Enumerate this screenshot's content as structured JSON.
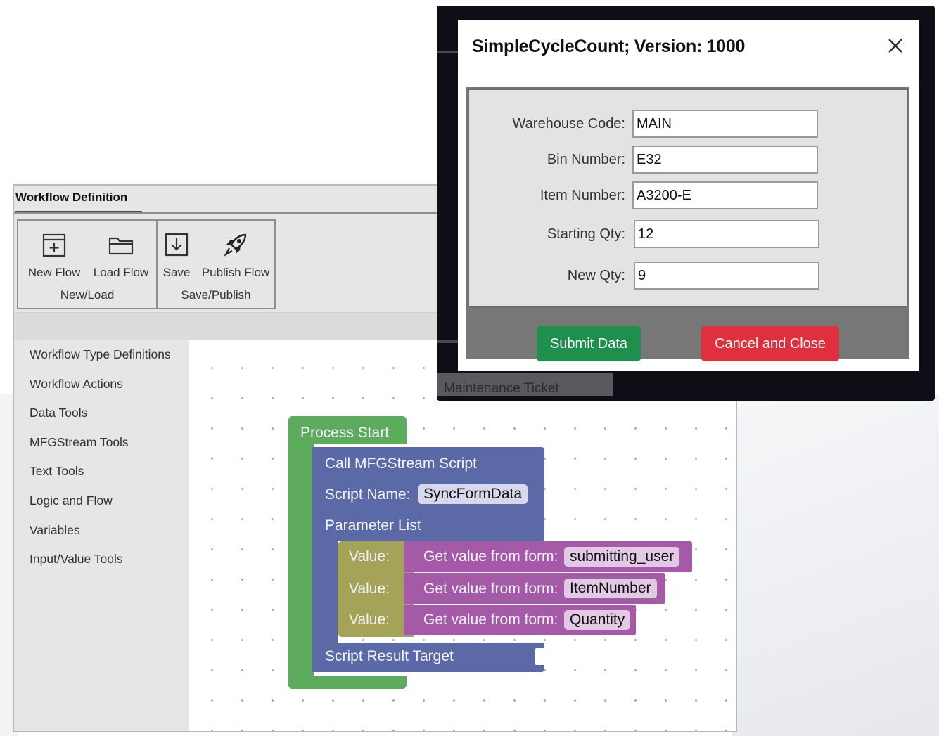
{
  "workflow": {
    "title": "Workflow Definition",
    "ribbon": {
      "group1": {
        "label": "New/Load",
        "buttons": [
          {
            "label": "New Flow",
            "icon": "new-flow-icon"
          },
          {
            "label": "Load Flow",
            "icon": "folder-icon"
          }
        ]
      },
      "group2": {
        "label": "Save/Publish",
        "buttons": [
          {
            "label": "Save",
            "icon": "save-icon"
          },
          {
            "label": "Publish Flow",
            "icon": "rocket-icon"
          }
        ]
      }
    },
    "sidebar": {
      "items": [
        "Workflow Type Definitions",
        "Workflow Actions",
        "Data Tools",
        "MFGStream Tools",
        "Text Tools",
        "Logic and Flow",
        "Variables",
        "Input/Value Tools"
      ]
    },
    "blocks": {
      "process_start": "Process Start",
      "call_script": "Call MFGStream Script",
      "script_name_label": "Script Name:",
      "script_name_value": "SyncFormData",
      "parameter_list": "Parameter List",
      "value_label": "Value:",
      "get_value_label": "Get value from form:",
      "params": [
        "submitting_user",
        "ItemNumber",
        "Quantity"
      ],
      "script_result_target": "Script Result Target"
    },
    "colors": {
      "green": "#5dab5c",
      "blue": "#5b69a6",
      "olive": "#a4a358",
      "magenta": "#a45aa7"
    }
  },
  "dialog": {
    "title": "SimpleCycleCount; Version: 1000",
    "fields": [
      {
        "label": "Warehouse Code:",
        "value": "MAIN"
      },
      {
        "label": "Bin Number:",
        "value": "E32"
      },
      {
        "label": "Item Number:",
        "value": "A3200-E"
      },
      {
        "label": "Starting Qty:",
        "value": "12"
      },
      {
        "label": "New Qty:",
        "value": "9"
      }
    ],
    "submit_label": "Submit Data",
    "cancel_label": "Cancel and Close",
    "behind_tab": "Maintenance Ticket"
  }
}
